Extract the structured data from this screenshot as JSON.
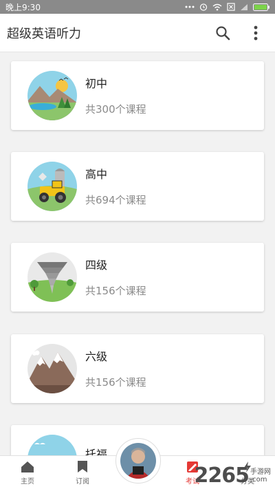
{
  "status_bar": {
    "time": "晚上9:30"
  },
  "app_bar": {
    "title": "超级英语听力",
    "search_icon": "search-icon",
    "more_icon": "more-vert-icon"
  },
  "courses": [
    {
      "title": "初中",
      "count": "共300个课程",
      "illustration": "mountain-lake-landscape"
    },
    {
      "title": "高中",
      "count": "共694个课程",
      "illustration": "tractor-farm"
    },
    {
      "title": "四级",
      "count": "共156个课程",
      "illustration": "tornado"
    },
    {
      "title": "六级",
      "count": "共156个课程",
      "illustration": "snowy-mountains"
    },
    {
      "title": "托福",
      "count": "",
      "illustration": "sydney-opera-house"
    }
  ],
  "bottom_nav": {
    "items": [
      {
        "label": "主页",
        "icon": "home-icon"
      },
      {
        "label": "订阅",
        "icon": "bookmark-icon"
      },
      {
        "label": "考试",
        "icon": "exam-icon",
        "active": true
      },
      {
        "label": "分类",
        "icon": "lightning-icon"
      }
    ]
  },
  "watermark": {
    "number": "2265",
    "site_top": "手游网",
    "site_bottom": ".com"
  },
  "colors": {
    "accent": "#e53935",
    "status_bar": "#8a8a8a"
  }
}
